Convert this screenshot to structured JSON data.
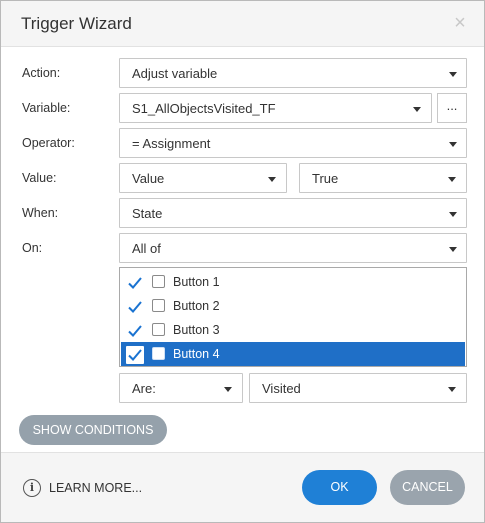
{
  "dialog": {
    "title": "Trigger Wizard",
    "close_glyph": "×"
  },
  "form": {
    "action": {
      "label": "Action:",
      "value": "Adjust variable"
    },
    "variable": {
      "label": "Variable:",
      "value": "S1_AllObjectsVisited_TF",
      "more_label": "..."
    },
    "operator": {
      "label": "Operator:",
      "value": "= Assignment"
    },
    "value_row": {
      "label": "Value:",
      "type_value": "Value",
      "value": "True"
    },
    "when": {
      "label": "When:",
      "value": "State"
    },
    "on": {
      "label": "On:",
      "value": "All of"
    }
  },
  "objects": [
    {
      "label": "Button 1",
      "checked": true,
      "selected": false
    },
    {
      "label": "Button 2",
      "checked": true,
      "selected": false
    },
    {
      "label": "Button 3",
      "checked": true,
      "selected": false
    },
    {
      "label": "Button 4",
      "checked": true,
      "selected": true
    }
  ],
  "condition": {
    "are_value": "Are:",
    "state_value": "Visited"
  },
  "buttons": {
    "show_conditions": "SHOW CONDITIONS",
    "learn_more": "LEARN MORE...",
    "ok": "OK",
    "cancel": "CANCEL"
  },
  "icons": {
    "info": "info-icon",
    "caret": "chevron-down-icon",
    "check": "checkmark-icon"
  },
  "colors": {
    "primary": "#1f80d6",
    "selection": "#1f6fc7",
    "secondary": "#9aa4ad",
    "check": "#1a73d1"
  }
}
